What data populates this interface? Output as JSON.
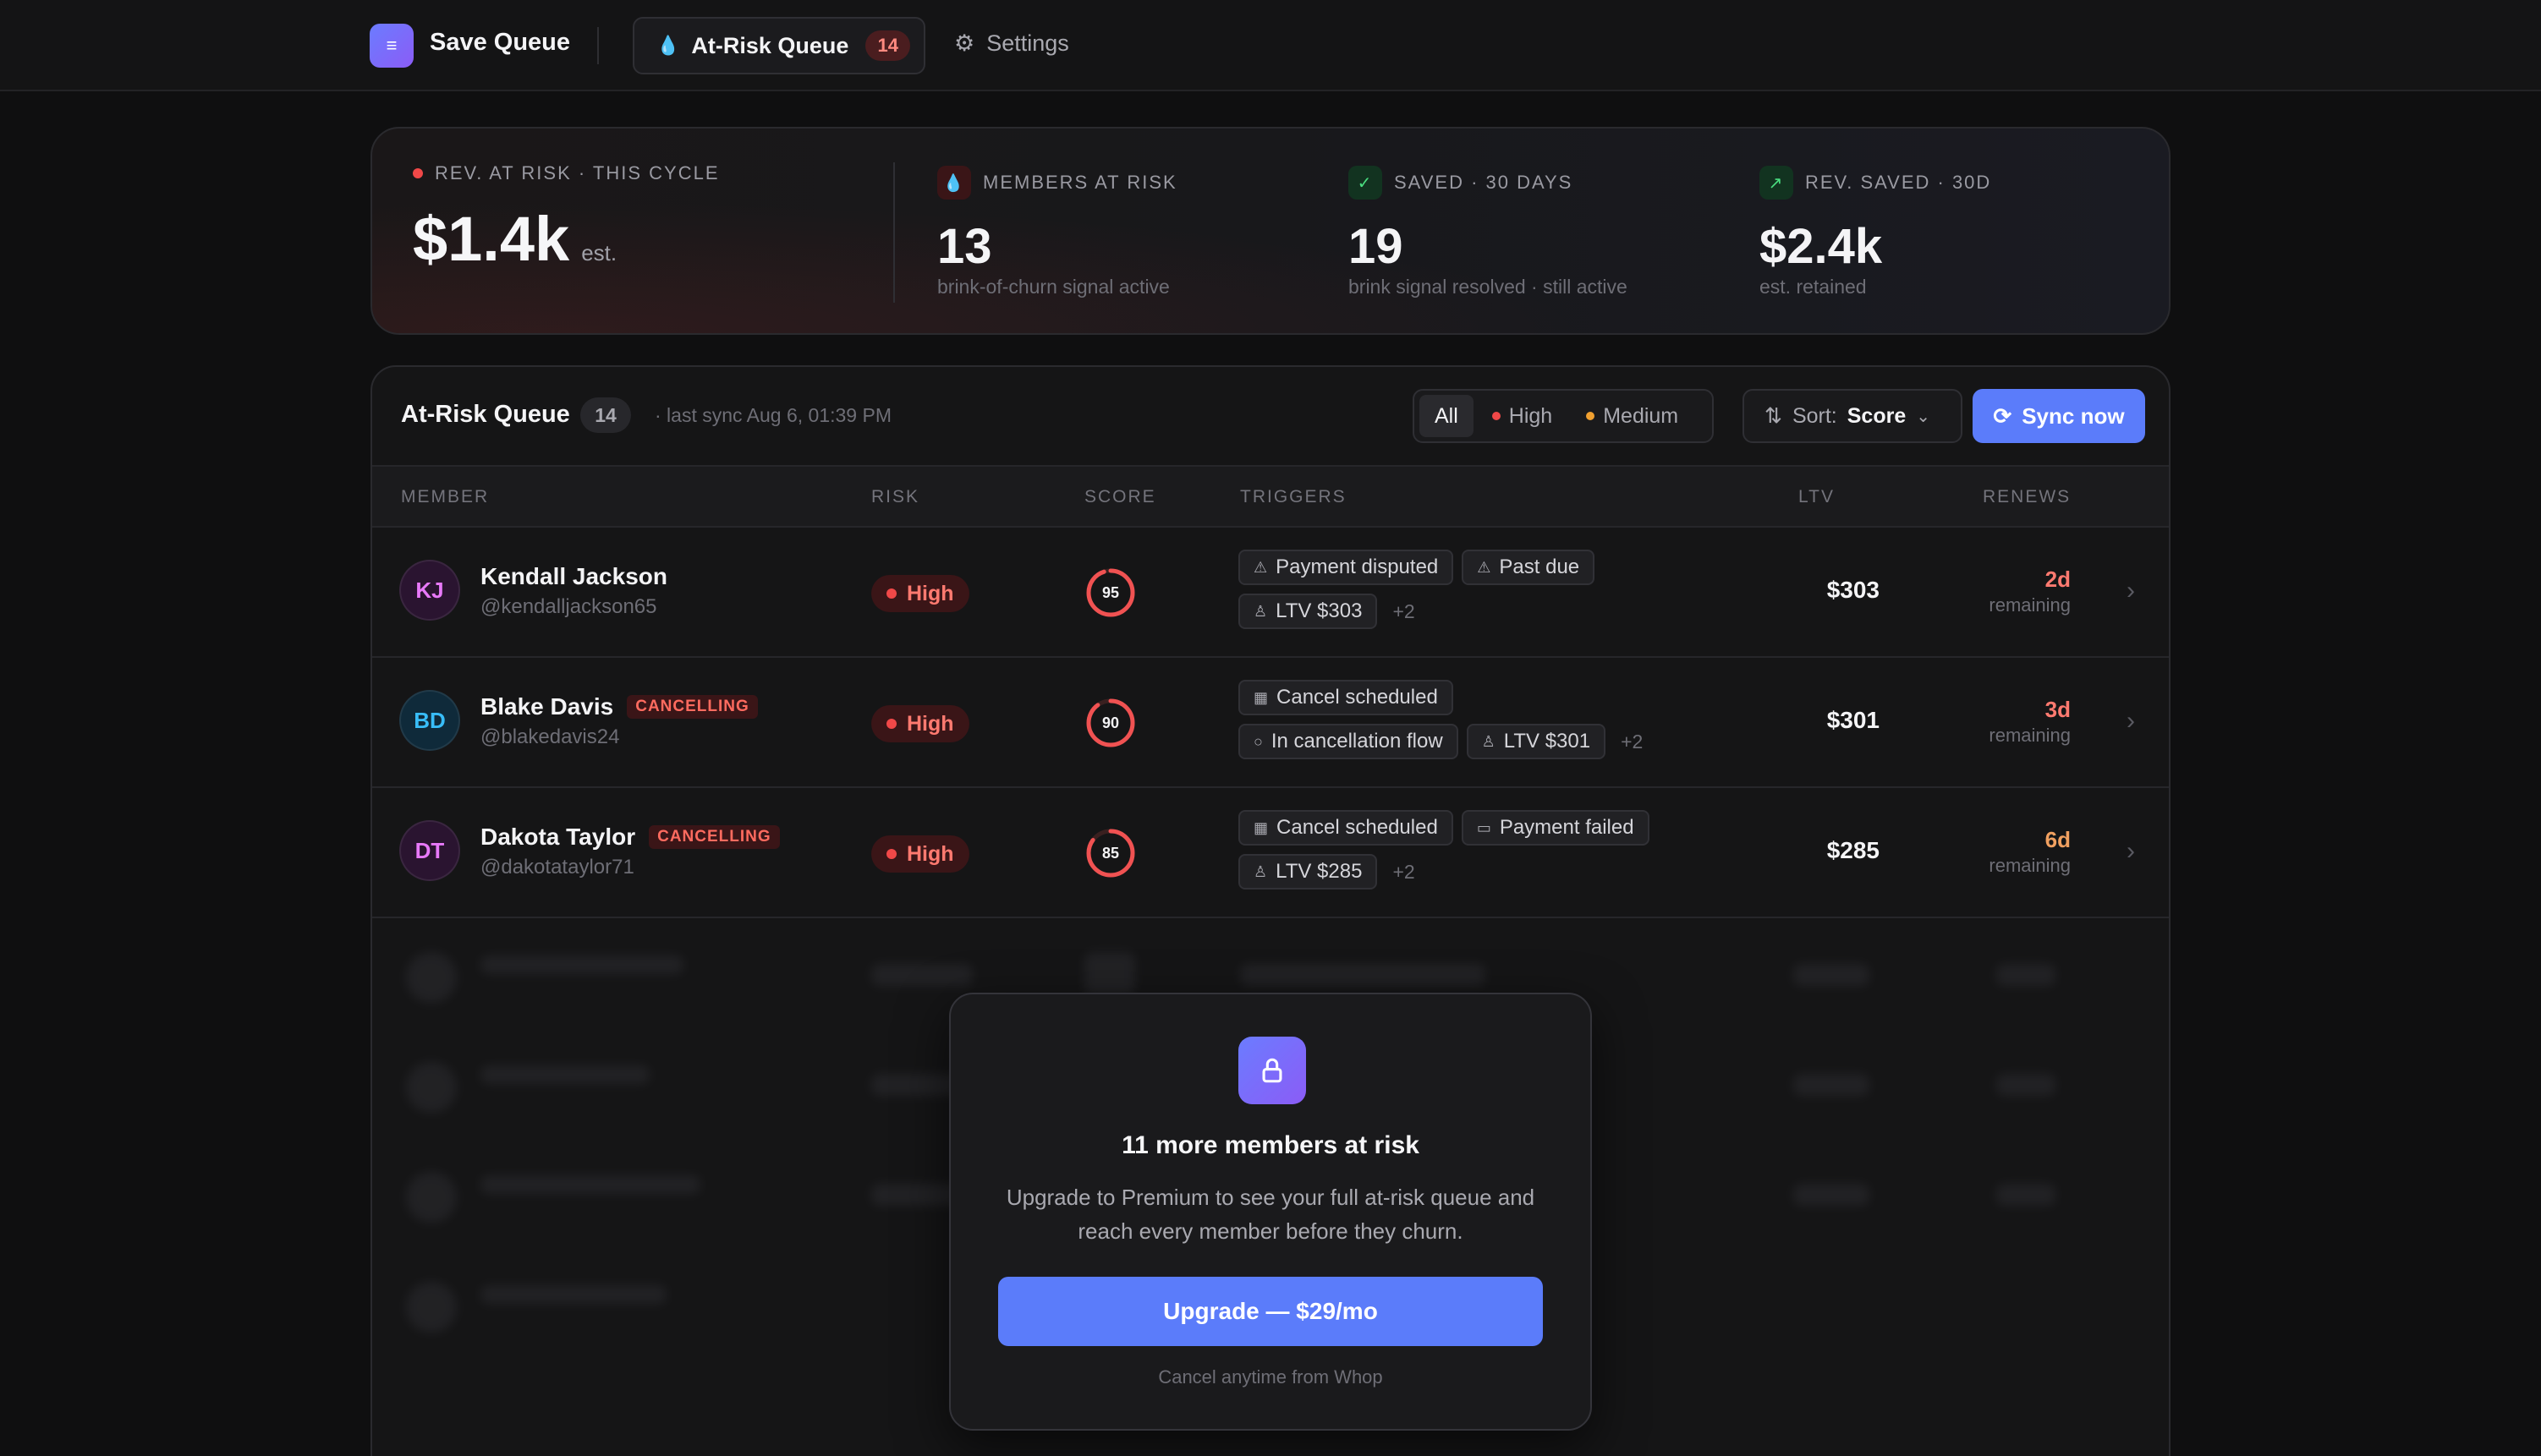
{
  "nav": {
    "brand": "Save Queue",
    "active_tab": "At-Risk Queue",
    "active_tab_badge": "14",
    "settings": "Settings"
  },
  "stats": {
    "rev_at_risk": {
      "label": "REV. AT RISK · THIS CYCLE",
      "value": "$1.4k",
      "suffix": "est."
    },
    "members_at_risk": {
      "label": "MEMBERS AT RISK",
      "value": "13",
      "sub": "brink-of-churn signal active"
    },
    "saved": {
      "label": "SAVED · 30 DAYS",
      "value": "19",
      "sub": "brink signal resolved · still active"
    },
    "rev_saved": {
      "label": "REV. SAVED · 30D",
      "value": "$2.4k",
      "sub": "est. retained"
    }
  },
  "queue": {
    "title": "At-Risk Queue",
    "count": "14",
    "last_sync": "· last sync Aug 6, 01:39 PM",
    "filters": {
      "all": "All",
      "high": "High",
      "medium": "Medium"
    },
    "sort_label": "Sort:",
    "sort_value": "Score",
    "sync_button": "Sync now",
    "columns": {
      "member": "MEMBER",
      "risk": "RISK",
      "score": "SCORE",
      "triggers": "TRIGGERS",
      "ltv": "LTV",
      "renews": "RENEWS"
    },
    "rows": [
      {
        "initials": "KJ",
        "name": "Kendall Jackson",
        "handle": "@kendalljackson65",
        "tag": "",
        "risk": "High",
        "score": 95,
        "triggers_line1": [
          "Payment disputed",
          "Past due"
        ],
        "triggers_line2": [
          "LTV $303"
        ],
        "more": "+2",
        "ltv": "$303",
        "renew_days": "2d",
        "renew_label": "remaining"
      },
      {
        "initials": "BD",
        "name": "Blake Davis",
        "handle": "@blakedavis24",
        "tag": "CANCELLING",
        "risk": "High",
        "score": 90,
        "triggers_line1": [
          "Cancel scheduled"
        ],
        "triggers_line2": [
          "In cancellation flow",
          "LTV $301"
        ],
        "more": "+2",
        "ltv": "$301",
        "renew_days": "3d",
        "renew_label": "remaining"
      },
      {
        "initials": "DT",
        "name": "Dakota Taylor",
        "handle": "@dakotataylor71",
        "tag": "CANCELLING",
        "risk": "High",
        "score": 85,
        "triggers_line1": [
          "Cancel scheduled",
          "Payment failed"
        ],
        "triggers_line2": [
          "LTV $285"
        ],
        "more": "+2",
        "ltv": "$285",
        "renew_days": "6d",
        "renew_label": "remaining"
      }
    ]
  },
  "upgrade": {
    "title": "11 more members at risk",
    "text": "Upgrade to Premium to see your full at-risk queue and reach every member before they churn.",
    "button": "Upgrade — $29/mo",
    "footnote": "Cancel anytime from Whop"
  },
  "colors": {
    "accent": "#5b7cfa",
    "danger": "#f04848",
    "medium": "#f0a030"
  }
}
